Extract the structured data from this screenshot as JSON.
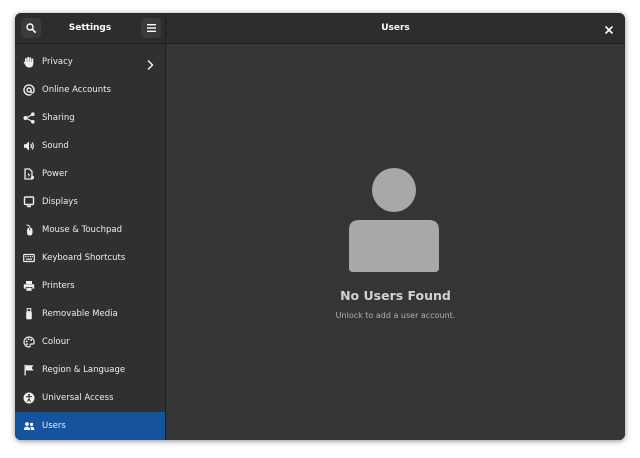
{
  "header": {
    "sidebar_title": "Settings",
    "page_title": "Users",
    "close_label": "×"
  },
  "sidebar": {
    "items": [
      {
        "label": "Privacy",
        "icon": "hand-icon",
        "has_arrow": true
      },
      {
        "label": "Online Accounts",
        "icon": "at-icon"
      },
      {
        "label": "Sharing",
        "icon": "share-icon"
      },
      {
        "label": "Sound",
        "icon": "speaker-icon"
      },
      {
        "label": "Power",
        "icon": "power-icon"
      },
      {
        "label": "Displays",
        "icon": "monitor-icon"
      },
      {
        "label": "Mouse & Touchpad",
        "icon": "mouse-icon"
      },
      {
        "label": "Keyboard Shortcuts",
        "icon": "keyboard-icon"
      },
      {
        "label": "Printers",
        "icon": "printer-icon"
      },
      {
        "label": "Removable Media",
        "icon": "usb-icon"
      },
      {
        "label": "Colour",
        "icon": "palette-icon"
      },
      {
        "label": "Region & Language",
        "icon": "flag-icon"
      },
      {
        "label": "Universal Access",
        "icon": "accessibility-icon"
      },
      {
        "label": "Users",
        "icon": "users-icon",
        "selected": true
      }
    ]
  },
  "main": {
    "empty_title": "No Users Found",
    "empty_subtitle": "Unlock to add a user account."
  },
  "colors": {
    "selected_bg": "#15539e",
    "sidebar_bg": "#303030",
    "main_bg": "#353535",
    "header_bg": "#2d2d2d"
  }
}
